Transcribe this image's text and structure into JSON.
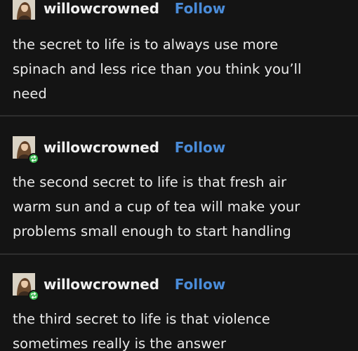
{
  "colors": {
    "background": "#141414",
    "text": "#ebebeb",
    "username": "#f0f0f0",
    "follow_link": "#4a8cd9",
    "reblog_badge": "#34b34a"
  },
  "posts": [
    {
      "username": "willowcrowned",
      "follow_label": "Follow",
      "avatar_icon": "avatar-portrait",
      "reblogged": false,
      "lines": [
        "the secret to life is to always use more",
        "spinach and less rice than you think you’ll",
        "need"
      ]
    },
    {
      "username": "willowcrowned",
      "follow_label": "Follow",
      "avatar_icon": "avatar-portrait",
      "reblogged": true,
      "lines": [
        "the second secret to life is that fresh air",
        "warm sun and a cup of tea will make your",
        "problems small enough to start handling"
      ]
    },
    {
      "username": "willowcrowned",
      "follow_label": "Follow",
      "avatar_icon": "avatar-portrait",
      "reblogged": true,
      "lines": [
        "the third secret to life is that violence",
        "sometimes really is the answer"
      ]
    }
  ]
}
